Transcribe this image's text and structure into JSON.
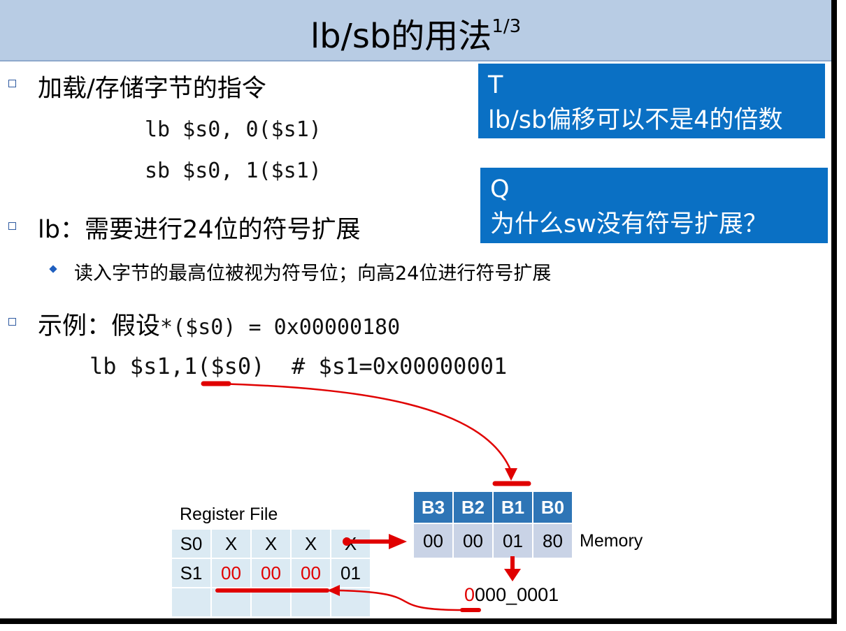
{
  "slide": {
    "title": "lb/sb的用法",
    "title_sup": "1/3"
  },
  "bullets": {
    "b1": "加载/存储字节的指令",
    "code1": "lb $s0, 0($s1)",
    "code2": "sb $s0, 1($s1)",
    "b2": "lb：需要进行24位的符号扩展",
    "b2_sub": "读入字节的最高位被视为符号位；向高24位进行符号扩展",
    "b3_prefix": "示例：假设",
    "b3_code": "*($s0) = 0x00000180",
    "example_code": "lb $s1,1($s0)  # $s1=0x00000001"
  },
  "callouts": {
    "t_label": "T",
    "t_text": "lb/sb偏移可以不是4的倍数",
    "q_label": "Q",
    "q_text": "为什么sw没有符号扩展？"
  },
  "register_file": {
    "label": "Register File",
    "rows": [
      [
        "S0",
        "X",
        "X",
        "X",
        "X"
      ],
      [
        "S1",
        "00",
        "00",
        "00",
        "01"
      ],
      [
        "",
        "",
        "",
        "",
        ""
      ]
    ]
  },
  "memory": {
    "label": "Memory",
    "headers": [
      "B3",
      "B2",
      "B1",
      "B0"
    ],
    "values": [
      "00",
      "00",
      "01",
      "80"
    ]
  },
  "result": {
    "first_digit": "0",
    "rest": "000_0001"
  },
  "colors": {
    "title_bg": "#b8cce4",
    "callout_bg": "#0a70c4",
    "arrow": "#e00000",
    "reg_cell": "#dbeaf3",
    "mem_head": "#2e75b6",
    "mem_cell": "#c9d3e6"
  }
}
